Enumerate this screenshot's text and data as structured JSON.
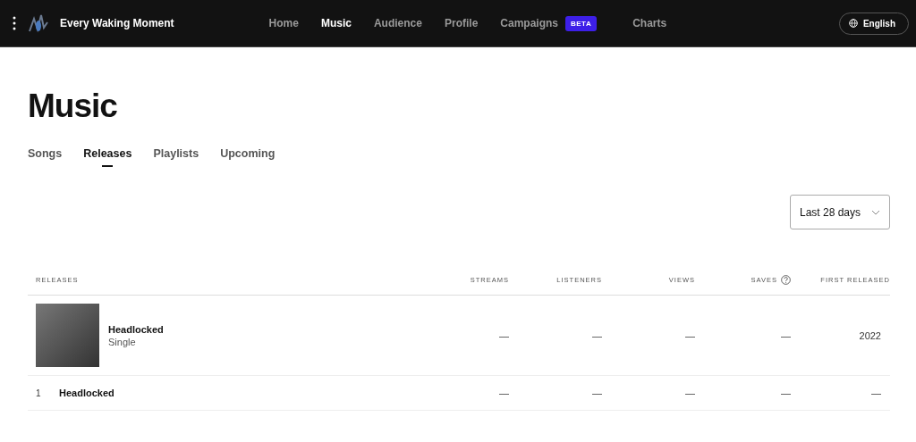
{
  "header": {
    "artist_name": "Every Waking Moment",
    "nav": [
      {
        "label": "Home",
        "selected": false
      },
      {
        "label": "Music",
        "selected": true
      },
      {
        "label": "Audience",
        "selected": false
      },
      {
        "label": "Profile",
        "selected": false
      },
      {
        "label": "Campaigns",
        "selected": false,
        "badge": "BETA"
      },
      {
        "label": "Charts",
        "selected": false
      }
    ],
    "language_button": "English"
  },
  "page_title": "Music",
  "tabs": [
    {
      "label": "Songs",
      "selected": false
    },
    {
      "label": "Releases",
      "selected": true
    },
    {
      "label": "Playlists",
      "selected": false
    },
    {
      "label": "Upcoming",
      "selected": false
    }
  ],
  "period_dropdown": {
    "value": "Last 28 days"
  },
  "table": {
    "columns": [
      {
        "label": "RELEASES",
        "help": false
      },
      {
        "label": "STREAMS",
        "help": false
      },
      {
        "label": "LISTENERS",
        "help": false
      },
      {
        "label": "VIEWS",
        "help": false
      },
      {
        "label": "SAVES",
        "help": true
      },
      {
        "label": "FIRST RELEASED",
        "help": false
      }
    ],
    "rows": [
      {
        "kind": "release",
        "title": "Headlocked",
        "subtitle": "Single",
        "streams": "—",
        "listeners": "—",
        "views": "—",
        "saves": "—",
        "first_released": "2022"
      },
      {
        "kind": "track",
        "index": "1",
        "title": "Headlocked",
        "streams": "—",
        "listeners": "—",
        "views": "—",
        "saves": "—",
        "first_released": "—"
      }
    ]
  }
}
